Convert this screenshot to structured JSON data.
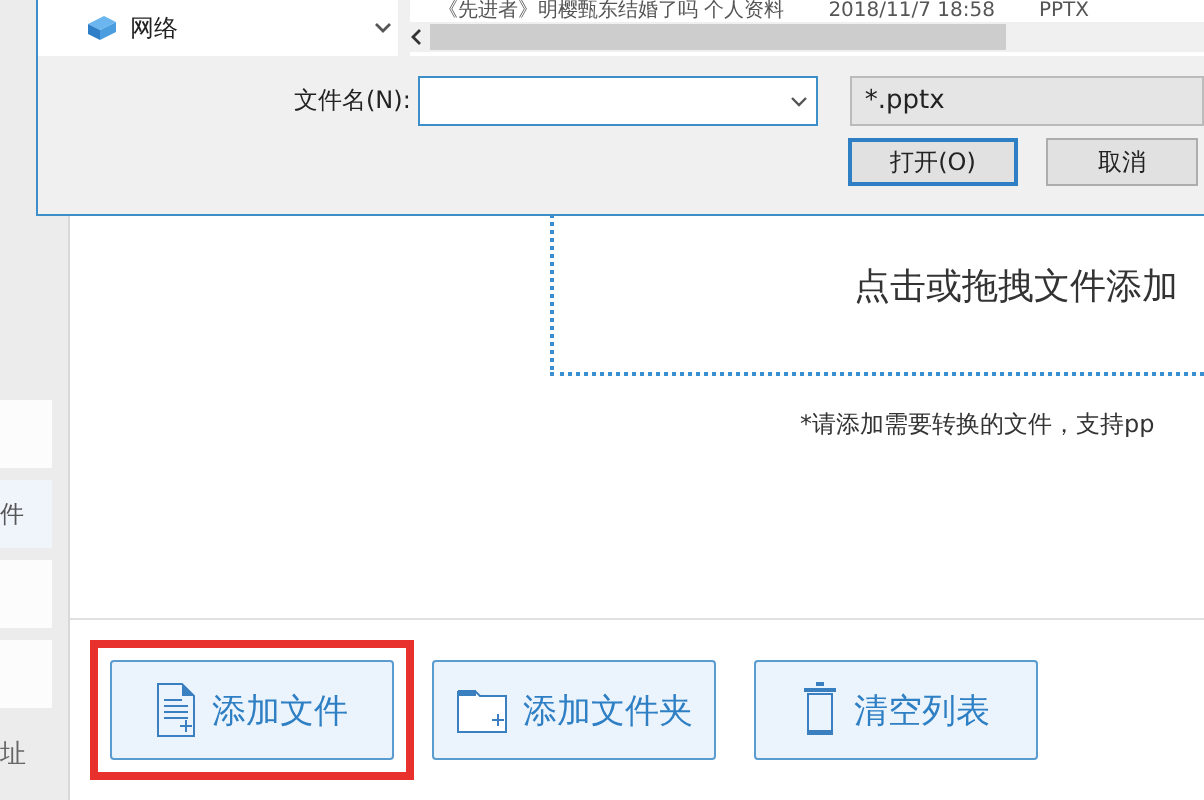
{
  "dialog": {
    "nav_item": "网络",
    "file_row": {
      "name": "《先进者》明樱甄东结婚了吗 个人资料",
      "date": "2018/11/7 18:58",
      "type": "PPTX"
    },
    "filename_label": "文件名(N):",
    "file_type": "*.pptx",
    "buttons": [
      {
        "label": "打开(O)",
        "default": true
      },
      {
        "label": "取消",
        "default": false
      }
    ]
  },
  "sidebar": {
    "tiles": [
      {
        "kind": "blank"
      },
      {
        "kind": "labeled",
        "label": "件"
      },
      {
        "kind": "blank"
      },
      {
        "kind": "blank"
      }
    ],
    "footer": "址"
  },
  "drop_zone": {
    "prompt": "点击或拖拽文件添加"
  },
  "note": "*请添加需要转换的文件，支持pp",
  "actions": [
    {
      "kind": "file",
      "label": "添加文件",
      "highlighted": true
    },
    {
      "kind": "folder",
      "label": "添加文件夹",
      "highlighted": false
    },
    {
      "kind": "trash",
      "label": "清空列表",
      "highlighted": false
    }
  ]
}
